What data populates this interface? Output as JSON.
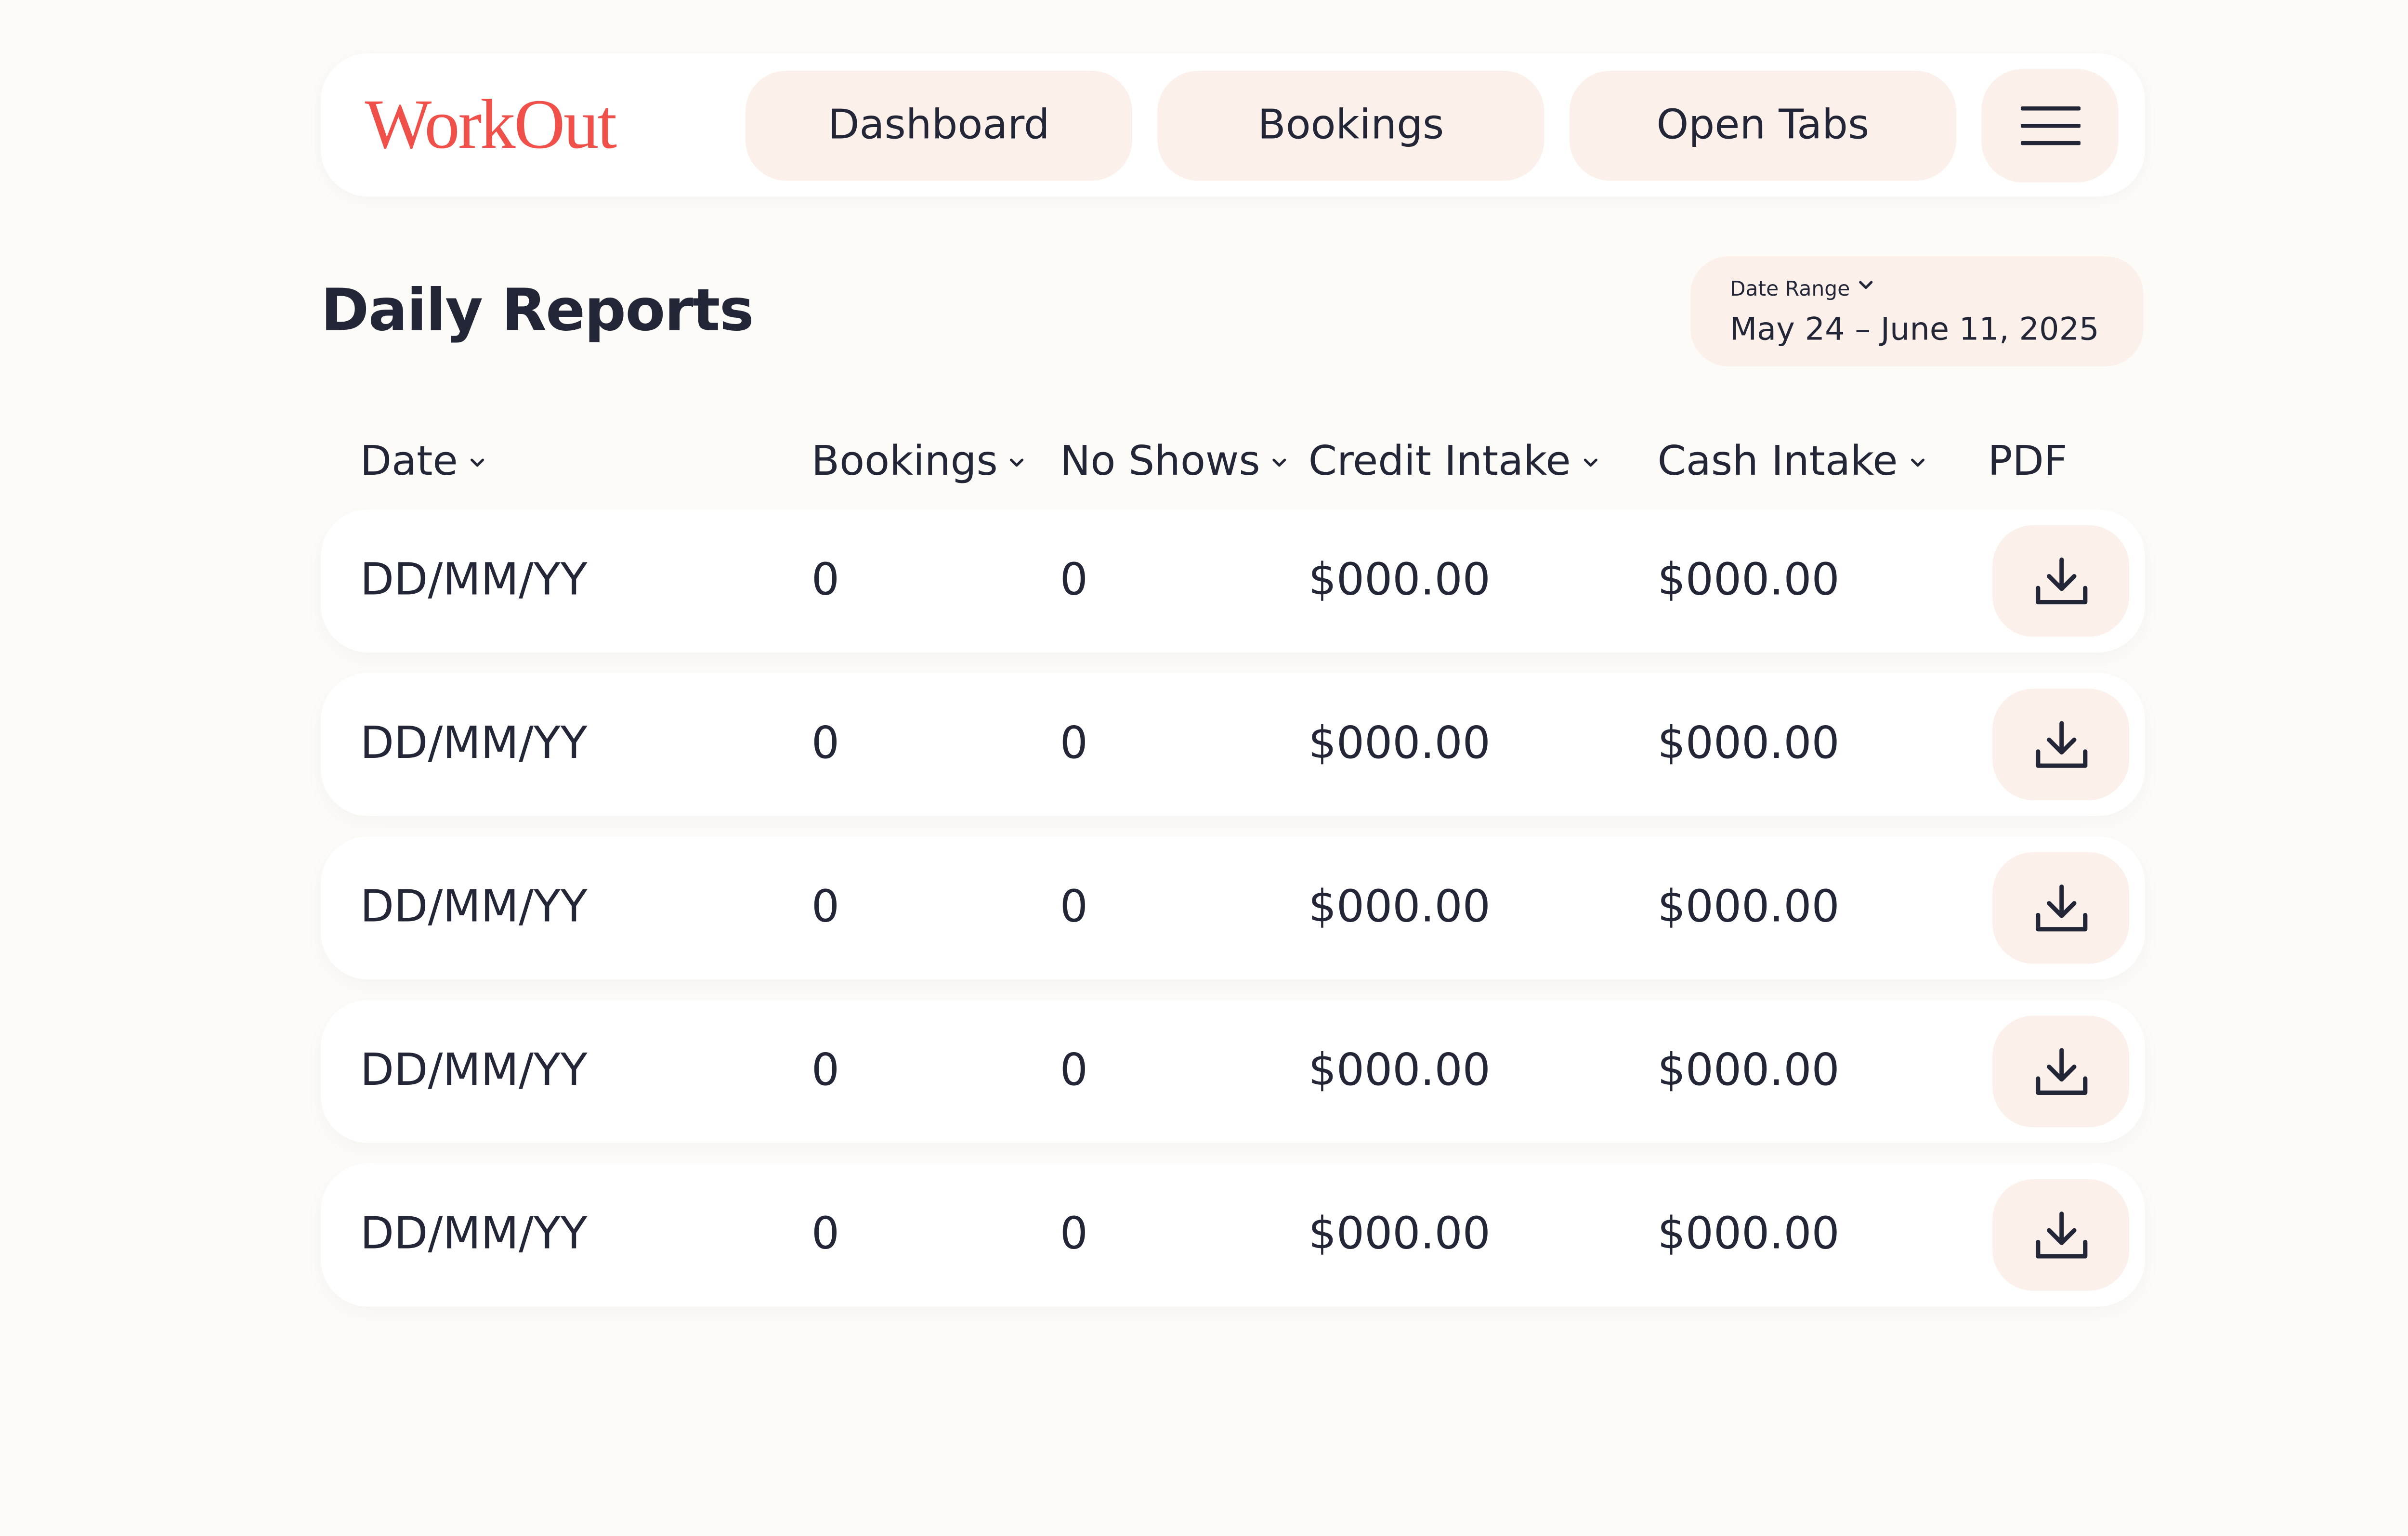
{
  "nav": {
    "logo": "WorkOut",
    "dashboard_label": "Dashboard",
    "bookings_label": "Bookings",
    "open_tabs_label": "Open Tabs",
    "menu_icon": "hamburger-menu-icon"
  },
  "page": {
    "title": "Daily Reports"
  },
  "date_range": {
    "label": "Date Range",
    "value": "May 24 – June 11, 2025"
  },
  "table": {
    "headers": {
      "date": "Date",
      "bookings": "Bookings",
      "no_shows": "No Shows",
      "credit_intake": "Credit Intake",
      "cash_intake": "Cash Intake",
      "pdf": "PDF"
    },
    "rows": [
      {
        "date": "DD/MM/YY",
        "bookings": "0",
        "no_shows": "0",
        "credit": "$000.00",
        "cash": "$000.00",
        "pdf_icon": "download-icon"
      },
      {
        "date": "DD/MM/YY",
        "bookings": "0",
        "no_shows": "0",
        "credit": "$000.00",
        "cash": "$000.00",
        "pdf_icon": "download-icon"
      },
      {
        "date": "DD/MM/YY",
        "bookings": "0",
        "no_shows": "0",
        "credit": "$000.00",
        "cash": "$000.00",
        "pdf_icon": "download-icon"
      },
      {
        "date": "DD/MM/YY",
        "bookings": "0",
        "no_shows": "0",
        "credit": "$000.00",
        "cash": "$000.00",
        "pdf_icon": "download-icon"
      },
      {
        "date": "DD/MM/YY",
        "bookings": "0",
        "no_shows": "0",
        "credit": "$000.00",
        "cash": "$000.00",
        "pdf_icon": "download-icon"
      }
    ]
  },
  "colors": {
    "background": "#FCFBF8",
    "card": "#FFFFFF",
    "pill": "#FCF0EB",
    "brand": "#F0504A",
    "text": "#222636"
  }
}
